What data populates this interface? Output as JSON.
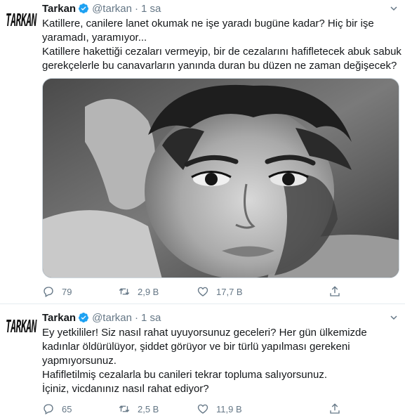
{
  "tweets": [
    {
      "author": {
        "name": "Tarkan",
        "handle": "@tarkan",
        "avatar_text": "TARKAN",
        "verified_icon": "verified-badge-icon"
      },
      "separator": "·",
      "time": "1 sa",
      "text_lines": [
        "Katillere, canilere lanet okumak ne işe yaradı bugüne kadar? Hiç bir işe",
        "yaramadı, yaramıyor...",
        "Katillere hakettiği cezaları vermeyip, bir de cezalarını hafifletecek abuk sabuk",
        "gerekçelerle bu canavarların yanında duran bu düzen ne zaman değişecek?"
      ],
      "media": {
        "type": "photo",
        "description_icon": "black-and-white-portrait-photo"
      },
      "actions": {
        "reply_count": "79",
        "retweet_count": "2,9 B",
        "like_count": "17,7 B"
      }
    },
    {
      "author": {
        "name": "Tarkan",
        "handle": "@tarkan",
        "avatar_text": "TARKAN",
        "verified_icon": "verified-badge-icon"
      },
      "separator": "·",
      "time": "1 sa",
      "text_lines": [
        "Ey yetkililer! Siz nasıl rahat uyuyorsunuz geceleri? Her gün ülkemizde",
        "kadınlar öldürülüyor, şiddet görüyor ve bir türlü yapılması gerekeni",
        "yapmıyorsunuz.",
        "Hafifletilmiş cezalarla bu canileri tekrar topluma salıyorsunuz.",
        "İçiniz, vicdanınız nasıl rahat ediyor?"
      ],
      "actions": {
        "reply_count": "65",
        "retweet_count": "2,5 B",
        "like_count": "11,9 B"
      }
    }
  ],
  "colors": {
    "verified": "#1da1f2",
    "muted": "#657786",
    "text": "#14171a",
    "divider": "#e6ecf0"
  }
}
